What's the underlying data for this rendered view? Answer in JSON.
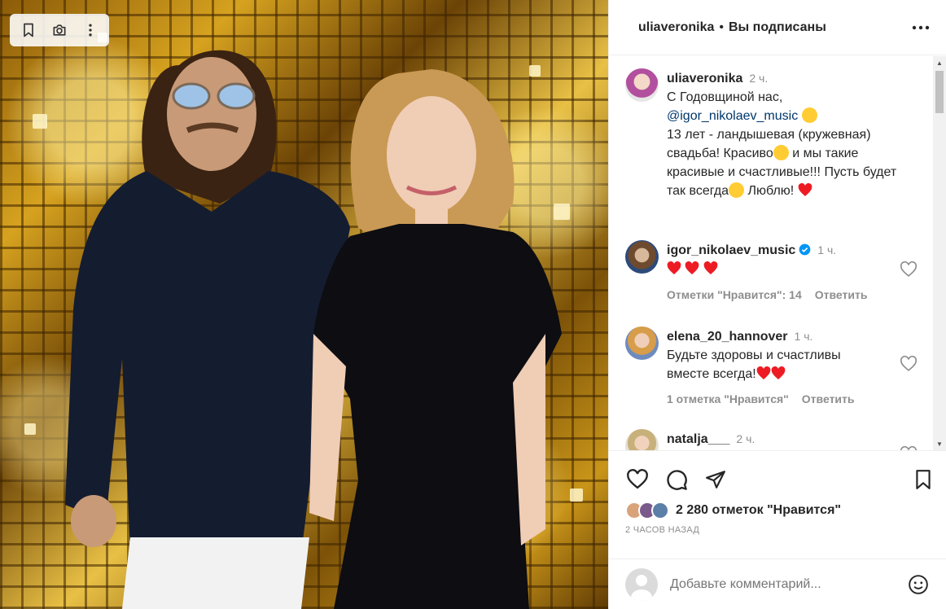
{
  "post": {
    "username": "uliaveronika",
    "follow_status": "Вы подписаны",
    "caption": {
      "username": "uliaveronika",
      "time": "2 ч.",
      "line1": "С Годовщиной нас,",
      "mention": "@igor_nikolaev_music",
      "line3": "13 лет - ландышевая (кружевная)",
      "line4a": "свадьба! Красиво",
      "line4b": " и мы такие",
      "line5": "красивые и счастливые!!! Пусть будет",
      "line6a": "так всегда",
      "line6b": " Люблю! "
    },
    "likes_count": "2 280 отметок \"Нравится\"",
    "posted_ago": "2 ЧАСОВ НАЗАД",
    "comment_placeholder": "Добавьте комментарий..."
  },
  "comments": [
    {
      "username": "igor_nikolaev_music",
      "verified": true,
      "time": "1 ч.",
      "likes": "Отметки \"Нравится\": 14",
      "reply": "Ответить"
    },
    {
      "username": "elena_20_hannover",
      "time": "1 ч.",
      "text_line1": "Будьте здоровы и счастливы",
      "text_line2": "вместе всегда!",
      "likes": "1 отметка \"Нравится\"",
      "reply": "Ответить"
    },
    {
      "username": "natalja___",
      "time": "2 ч."
    }
  ],
  "colors": {
    "text": "#262626",
    "secondary": "#8e8e8e",
    "mention": "#00376b",
    "heart_red": "#ed1c24",
    "verified_blue": "#0095f6"
  },
  "icons": {
    "toolbar": [
      "bookmark-icon",
      "camera-search-icon",
      "more-vertical-icon"
    ],
    "actions": [
      "heart-icon",
      "comment-icon",
      "share-icon",
      "save-icon"
    ]
  }
}
